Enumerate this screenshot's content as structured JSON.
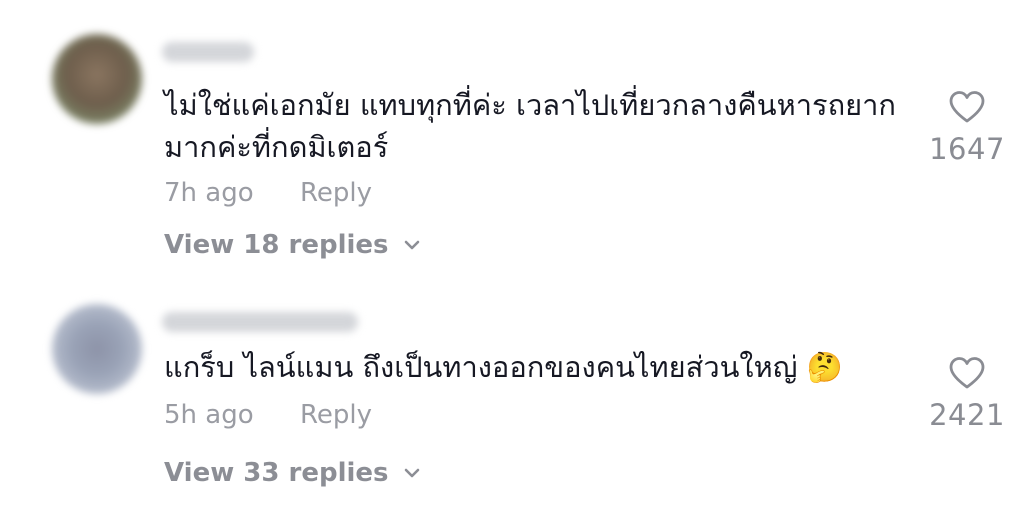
{
  "comments": [
    {
      "text": "ไม่ใช่แค่เอกมัย แทบทุกที่ค่ะ เวลาไปเที่ยวกลางคืนหารถยากมากค่ะที่กดมิเตอร์",
      "time": "7h ago",
      "reply_label": "Reply",
      "view_replies": "View 18 replies",
      "likes": "1647"
    },
    {
      "text": "แกร็บ ไลน์แมน ถึงเป็นทางออกของคนไทยส่วนใหญ่ 🤔",
      "time": "5h ago",
      "reply_label": "Reply",
      "view_replies": "View 33 replies",
      "likes": "2421"
    }
  ],
  "icons": {
    "like": "heart-outline-icon",
    "expand": "chevron-down-icon"
  },
  "colors": {
    "text": "#161823",
    "muted": "#9a9ca3"
  }
}
